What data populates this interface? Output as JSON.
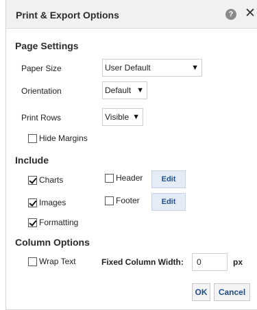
{
  "dialog": {
    "title": "Print & Export Options",
    "help_icon": "?",
    "close_icon": "✕"
  },
  "page_settings": {
    "heading": "Page Settings",
    "paper_size_label": "Paper Size",
    "paper_size_value": "User Default",
    "orientation_label": "Orientation",
    "orientation_value": "Default",
    "print_rows_label": "Print Rows",
    "print_rows_value": "Visible",
    "hide_margins_label": "Hide Margins",
    "hide_margins_checked": false
  },
  "include": {
    "heading": "Include",
    "charts_label": "Charts",
    "charts_checked": true,
    "images_label": "Images",
    "images_checked": true,
    "formatting_label": "Formatting",
    "formatting_checked": true,
    "header_label": "Header",
    "header_checked": false,
    "footer_label": "Footer",
    "footer_checked": false,
    "edit_label": "Edit"
  },
  "column_options": {
    "heading": "Column Options",
    "wrap_text_label": "Wrap Text",
    "wrap_text_checked": false,
    "fixed_width_label": "Fixed Column Width:",
    "fixed_width_value": "0",
    "unit_label": "px"
  },
  "footer": {
    "ok_label": "OK",
    "cancel_label": "Cancel"
  },
  "icons": {
    "help": "help-icon",
    "close": "close-icon",
    "dropdown": "triangle-down-icon"
  },
  "colors": {
    "titlebar_bg": "#f1f1f1",
    "edit_button_bg": "#e4edf7",
    "link_text": "#1f4e8c"
  }
}
